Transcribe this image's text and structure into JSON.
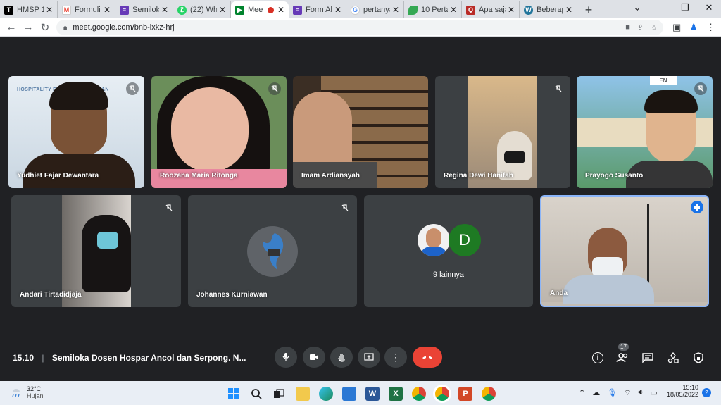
{
  "browser": {
    "tabs": [
      {
        "label": "HMSP 1(",
        "icon": "document-icon"
      },
      {
        "label": "Formulir",
        "icon": "gmail-icon"
      },
      {
        "label": "Semilok",
        "icon": "forms-icon"
      },
      {
        "label": "(22) Wh",
        "icon": "whatsapp-icon"
      },
      {
        "label": "Mee",
        "icon": "meet-icon"
      },
      {
        "label": "Form Ab",
        "icon": "forms-icon"
      },
      {
        "label": "pertanya",
        "icon": "google-icon"
      },
      {
        "label": "10 Perta",
        "icon": "leaf-icon"
      },
      {
        "label": "Apa saja",
        "icon": "quora-icon"
      },
      {
        "label": "Beberap",
        "icon": "wordpress-icon"
      }
    ],
    "url": "meet.google.com/bnb-ixkz-hrj"
  },
  "participants": [
    {
      "name": "Yudhiet Fajar Dewantara",
      "banner": "HOSPITALITY D",
      "banner2": "S PERHOTELAN"
    },
    {
      "name": "Roozana Maria Ritonga"
    },
    {
      "name": "Imam Ardiansyah"
    },
    {
      "name": "Regina Dewi Hanifah"
    },
    {
      "name": "Prayogo Susanto",
      "caption_badge": "EN"
    },
    {
      "name": "Andari Tirtadidjaja"
    },
    {
      "name": "Johannes Kurniawan"
    },
    {
      "name": "9 lainnya",
      "avatar_letter": "D"
    },
    {
      "name": "Anda"
    }
  ],
  "meeting": {
    "time": "15.10",
    "separator": "|",
    "title": "Semiloka Dosen Hospar Ancol dan Serpong. N...",
    "people_count": "17"
  },
  "taskbar": {
    "weather_temp": "32°C",
    "weather_desc": "Hujan",
    "clock_time": "15:10",
    "clock_date": "18/05/2022",
    "notif_count": "2"
  },
  "colors": {
    "end_call": "#ea4335",
    "accent": "#8ab4f8",
    "meet_bg": "#202124"
  }
}
